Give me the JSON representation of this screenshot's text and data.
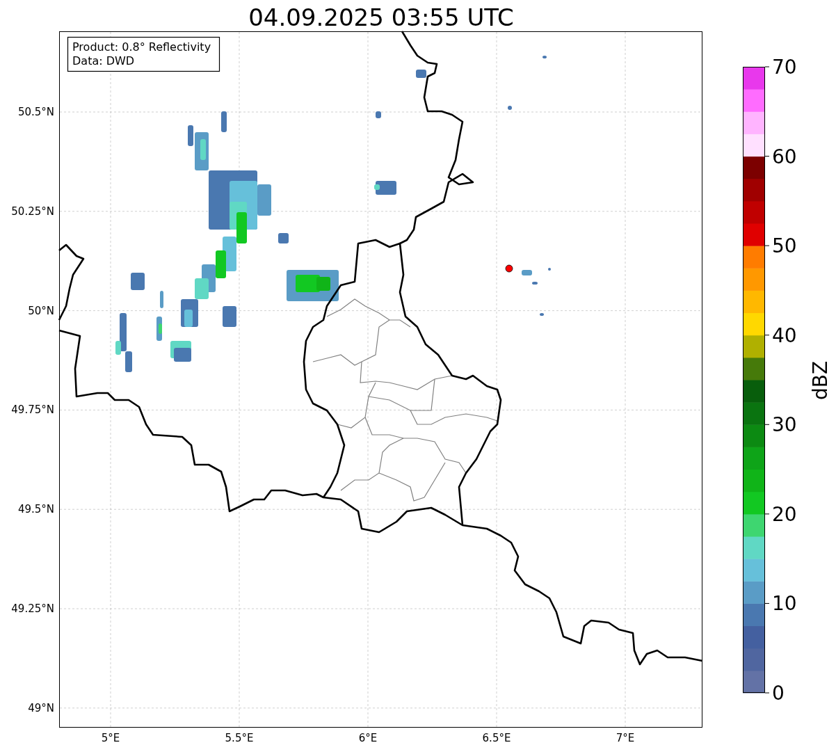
{
  "title": "04.09.2025 03:55 UTC",
  "info_box": [
    "Product: 0.8° Reflectivity",
    "Data: DWD"
  ],
  "map": {
    "xticks": [
      "5°E",
      "5.5°E",
      "6°E",
      "6.5°E",
      "7°E"
    ],
    "yticks": [
      "50.5°N",
      "50.25°N",
      "50°N",
      "49.75°N",
      "49.5°N",
      "49.25°N",
      "49°N"
    ]
  },
  "colorbar": {
    "label": "dBZ",
    "ticks": [
      "70",
      "60",
      "50",
      "40",
      "30",
      "20",
      "10",
      "0"
    ]
  }
}
